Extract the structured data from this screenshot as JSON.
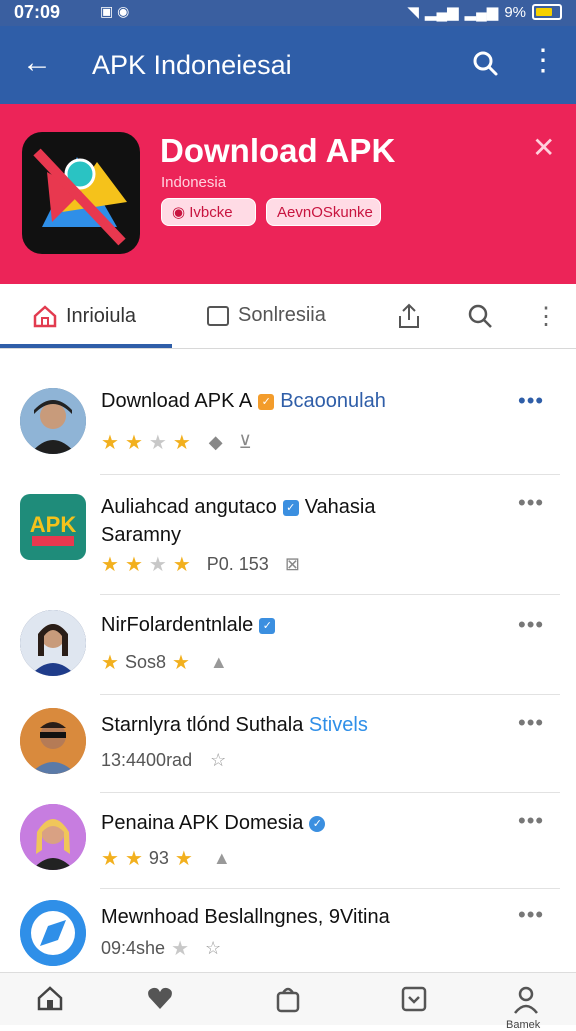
{
  "status_bar": {
    "time": "07:09",
    "battery": "9%"
  },
  "app_bar": {
    "title": "APK Indoneiesai"
  },
  "banner": {
    "title": "Download APK",
    "subtitle": "Indonesia",
    "chips": [
      "Ivbcke",
      "AevnOSkunke"
    ]
  },
  "tabs": [
    {
      "label": "Inrioiula"
    },
    {
      "label": "Sonlresiia"
    }
  ],
  "list": [
    {
      "title": "Download APK A",
      "tag": "Bcaoonulah",
      "meta": "",
      "rating": 3
    },
    {
      "title": "Auliahcad angutaco",
      "tag": "Vahasia",
      "title2": "Saramny",
      "meta": "P0. 153",
      "rating": 3
    },
    {
      "title": "NirFolardentnlale",
      "tag": "",
      "meta": "Sos8",
      "rating": 2
    },
    {
      "title": "Starnlyra tlónd Suthala",
      "tag": "Stivels",
      "meta": "13:4400rad",
      "rating": 0
    },
    {
      "title": "Penaina APK Domesia",
      "tag": "",
      "meta": "93",
      "rating": 3
    },
    {
      "title": "Mewnhoad Beslallngnes, 9Vitina",
      "tag": "",
      "meta": "09:4she",
      "rating": 0
    }
  ],
  "bottom_nav": {
    "label": "Bamek"
  },
  "colors": {
    "primary": "#2f5ea8",
    "banner": "#ec2458",
    "star": "#f2b01e"
  }
}
